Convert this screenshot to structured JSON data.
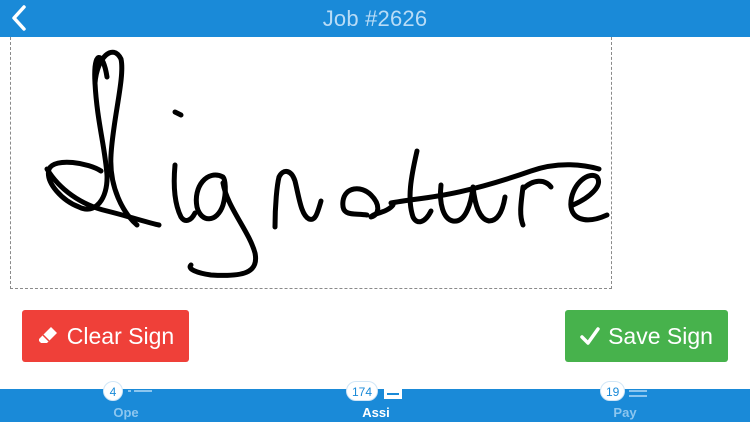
{
  "header": {
    "title": "Job #2626",
    "back_icon": "chevron-left-icon"
  },
  "signature_pad": {
    "state": "signed",
    "stroke_color": "#000000",
    "signature_text": "Signature"
  },
  "actions": {
    "clear_label": "Clear Sign",
    "clear_icon": "eraser-icon",
    "clear_color": "#ef4039",
    "save_label": "Save Sign",
    "save_icon": "checkmark-icon",
    "save_color": "#47b24c"
  },
  "tabs": [
    {
      "label": "Ope",
      "badge": "4",
      "icon": "list-icon",
      "active": false
    },
    {
      "label": "Assi",
      "badge": "174",
      "icon": "clipboard-icon",
      "active": true
    },
    {
      "label": "Pay",
      "badge": "19",
      "icon": "menu-icon",
      "active": false
    }
  ],
  "colors": {
    "brand_blue": "#1a8ad8",
    "title_text": "#b9dcf6"
  }
}
